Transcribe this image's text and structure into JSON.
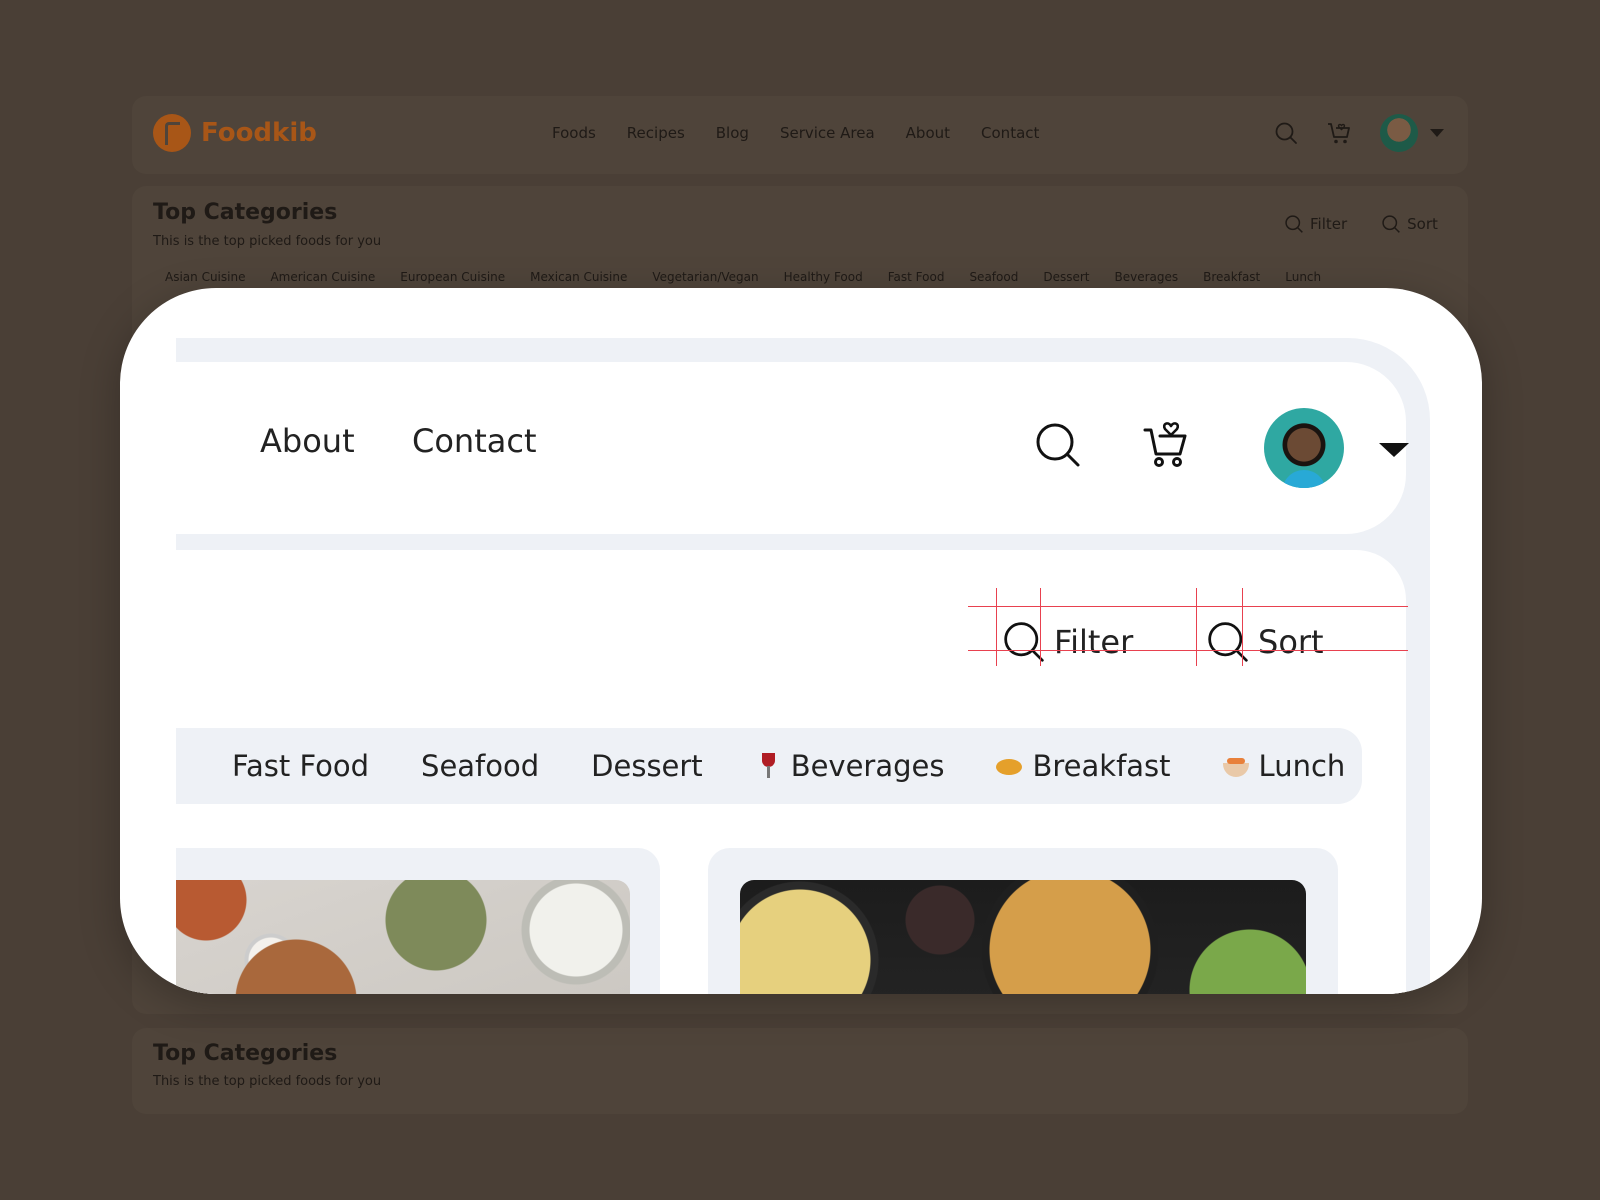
{
  "brand": {
    "name": "Foodkib",
    "color": "#a85617"
  },
  "nav": {
    "items": [
      "Foods",
      "Recipes",
      "Blog",
      "Service Area",
      "About",
      "Contact"
    ]
  },
  "icons": {
    "search": "search-icon",
    "cart": "cart-heart-icon",
    "avatar": "user-avatar",
    "dropdown": "chevron-down-icon"
  },
  "section": {
    "title": "Top Categories",
    "subtitle": "This is the top picked foods for you",
    "filter_label": "Filter",
    "sort_label": "Sort"
  },
  "categories_bg": [
    "Asian Cuisine",
    "American Cuisine",
    "European Cuisine",
    "Mexican Cuisine",
    "Vegetarian/Vegan",
    "Healthy Food",
    "Fast Food",
    "Seafood",
    "Dessert",
    "Beverages",
    "Breakfast",
    "Lunch"
  ],
  "zoom": {
    "nav_about": "About",
    "nav_contact": "Contact",
    "filter_label": "Filter",
    "sort_label": "Sort",
    "chips": {
      "fast_food": "Fast Food",
      "seafood": "Seafood",
      "dessert": "Dessert",
      "beverages": "Beverages",
      "breakfast": "Breakfast",
      "lunch": "Lunch"
    }
  },
  "colors": {
    "overlay_bg": "#4a3f36",
    "guide": "#e8414f",
    "surface": "#eef1f6"
  }
}
